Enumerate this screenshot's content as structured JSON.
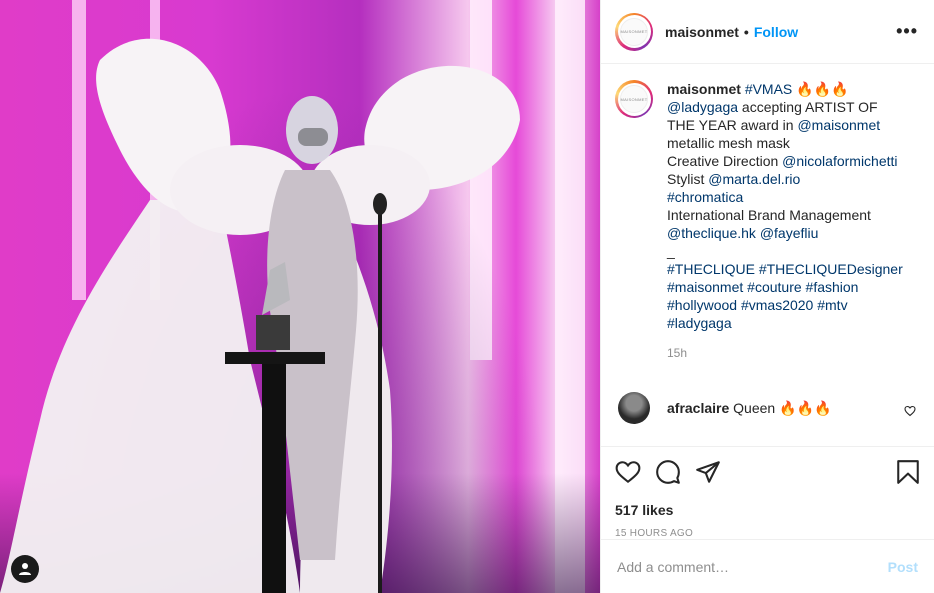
{
  "post": {
    "username": "maisonmet",
    "follow_label": "Follow",
    "more_label": "•••",
    "avatar_logo_text": "MAISONMET"
  },
  "caption": {
    "username": "maisonmet",
    "lines": [
      [
        {
          "t": "#VMAS",
          "tag": true
        },
        {
          "t": " 🔥🔥🔥",
          "tag": false
        }
      ],
      [
        {
          "t": "@ladygaga",
          "tag": true
        },
        {
          "t": " accepting ARTIST OF",
          "tag": false
        }
      ],
      [
        {
          "t": "THE YEAR award in ",
          "tag": false
        },
        {
          "t": "@maisonmet",
          "tag": true
        }
      ],
      [
        {
          "t": "metallic mesh mask",
          "tag": false
        }
      ],
      [
        {
          "t": "Creative Direction ",
          "tag": false
        },
        {
          "t": "@nicolaformichetti",
          "tag": true
        }
      ],
      [
        {
          "t": "Stylist ",
          "tag": false
        },
        {
          "t": "@marta.del.rio",
          "tag": true
        }
      ],
      [
        {
          "t": "#chromatica",
          "tag": true
        }
      ],
      [
        {
          "t": "International Brand Management",
          "tag": false
        }
      ],
      [
        {
          "t": "@theclique.hk",
          "tag": true
        },
        {
          "t": " ",
          "tag": false
        },
        {
          "t": "@fayefliu",
          "tag": true
        }
      ],
      [
        {
          "t": "_",
          "tag": false
        }
      ],
      [
        {
          "t": " ",
          "tag": false
        }
      ],
      [
        {
          "t": "#THECLIQUE",
          "tag": true
        },
        {
          "t": " ",
          "tag": false
        },
        {
          "t": "#THECLIQUEDesigner",
          "tag": true
        }
      ],
      [
        {
          "t": "#maisonmet",
          "tag": true
        },
        {
          "t": " ",
          "tag": false
        },
        {
          "t": "#couture",
          "tag": true
        },
        {
          "t": " ",
          "tag": false
        },
        {
          "t": "#fashion",
          "tag": true
        }
      ],
      [
        {
          "t": "#hollywood",
          "tag": true
        },
        {
          "t": " ",
          "tag": false
        },
        {
          "t": "#vmas2020",
          "tag": true
        },
        {
          "t": " ",
          "tag": false
        },
        {
          "t": "#mtv",
          "tag": true
        }
      ],
      [
        {
          "t": "#ladygaga",
          "tag": true
        }
      ]
    ],
    "time": "15h"
  },
  "comment": {
    "username": "afraclaire",
    "text": "Queen 🔥🔥🔥"
  },
  "stats": {
    "likes": "517 likes",
    "ago": "15 HOURS AGO"
  },
  "add_comment": {
    "placeholder": "Add a comment…",
    "post_label": "Post"
  },
  "colors": {
    "link": "#00376b",
    "follow": "#0095f6",
    "post_disabled": "#b2dffc",
    "muted": "#8e8e8e"
  }
}
